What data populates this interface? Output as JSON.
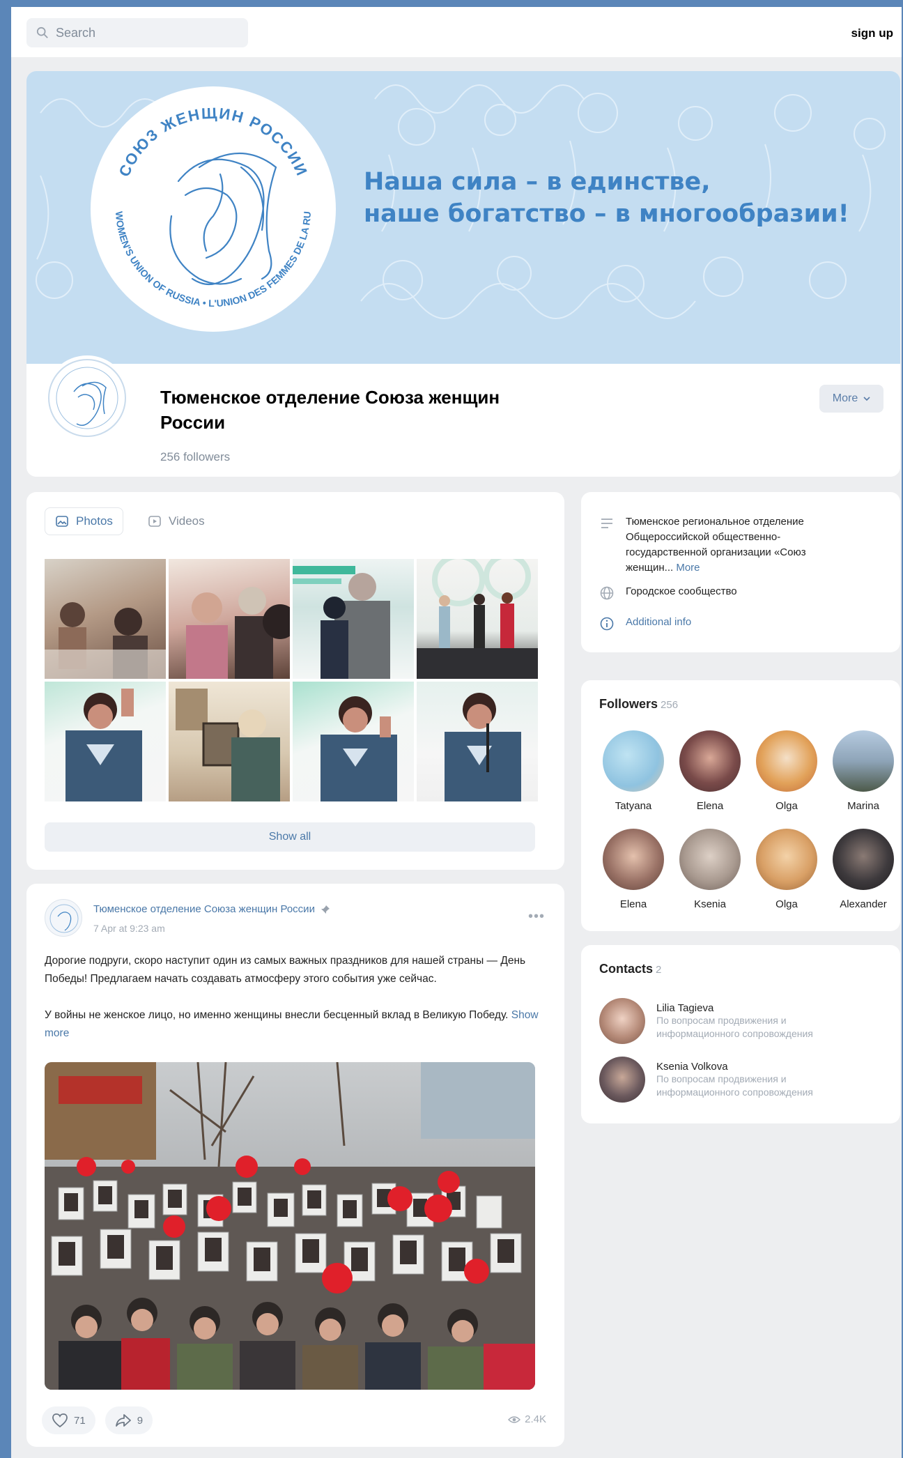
{
  "search": {
    "placeholder": "Search"
  },
  "header": {
    "signup_label": "sign up"
  },
  "cover": {
    "slogan_line1": "Наша сила – в единстве,",
    "slogan_line2": "наше богатство – в многообразии!",
    "seal_text_top": "СОЮЗ ЖЕНЩИН РОССИИ",
    "seal_text_right": "L'UNION DES FEMMES DE LA RUSSIE",
    "seal_text_left": "THE WOMEN'S UNION OF RUSSIA"
  },
  "group": {
    "name": "Тюменское отделение Союза женщин России",
    "followers": "256 followers",
    "more_label": "More"
  },
  "media": {
    "tabs": [
      {
        "label": "Photos",
        "icon": "photo-icon"
      },
      {
        "label": "Videos",
        "icon": "video-icon"
      }
    ],
    "show_all_label": "Show all"
  },
  "post": {
    "author": "Тюменское отделение Союза женщин России",
    "date": "7 Apr at 9:23 am",
    "paragraph1": "Дорогие подруги, скоро наступит один из самых важных праздников для нашей страны — День Победы! Предлагаем начать создавать атмосферу этого события уже сейчас.",
    "paragraph2": "У войны не женское лицо, но именно женщины внесли бесценный вклад в Великую Победу.",
    "show_more": "Show more",
    "likes": "71",
    "shares": "9",
    "views": "2.4K"
  },
  "info": {
    "description": "Тюменское региональное отделение Общероссийской общественно-государственной организации «Союз женщин...",
    "description_more": "More",
    "category": "Городское сообщество",
    "additional": "Additional info"
  },
  "followers": {
    "title": "Followers",
    "count": "256",
    "people": [
      {
        "name": "Tatyana",
        "color": "#8fc3e0"
      },
      {
        "name": "Elena",
        "color": "#7a4b4a"
      },
      {
        "name": "Olga",
        "color": "#e2a25a"
      },
      {
        "name": "Marina",
        "color": "#6f8aa3"
      },
      {
        "name": "Elena",
        "color": "#9a7266"
      },
      {
        "name": "Ksenia",
        "color": "#a99a90"
      },
      {
        "name": "Olga",
        "color": "#d9a066"
      },
      {
        "name": "Alexander",
        "color": "#3e3a3d"
      }
    ]
  },
  "contacts": {
    "title": "Contacts",
    "count": "2",
    "people": [
      {
        "name": "Lilia Tagieva",
        "role": "По вопросам продвижения и информационного сопровождения",
        "color": "#b58a78"
      },
      {
        "name": "Ksenia Volkova",
        "role": "По вопросам продвижения и информационного сопровождения",
        "color": "#6c5a5e"
      }
    ]
  },
  "colors": {
    "accent": "#4a78a8",
    "cover_bg": "#c4ddf1",
    "slogan": "#3f83c4",
    "page_bg": "#edeef0"
  }
}
